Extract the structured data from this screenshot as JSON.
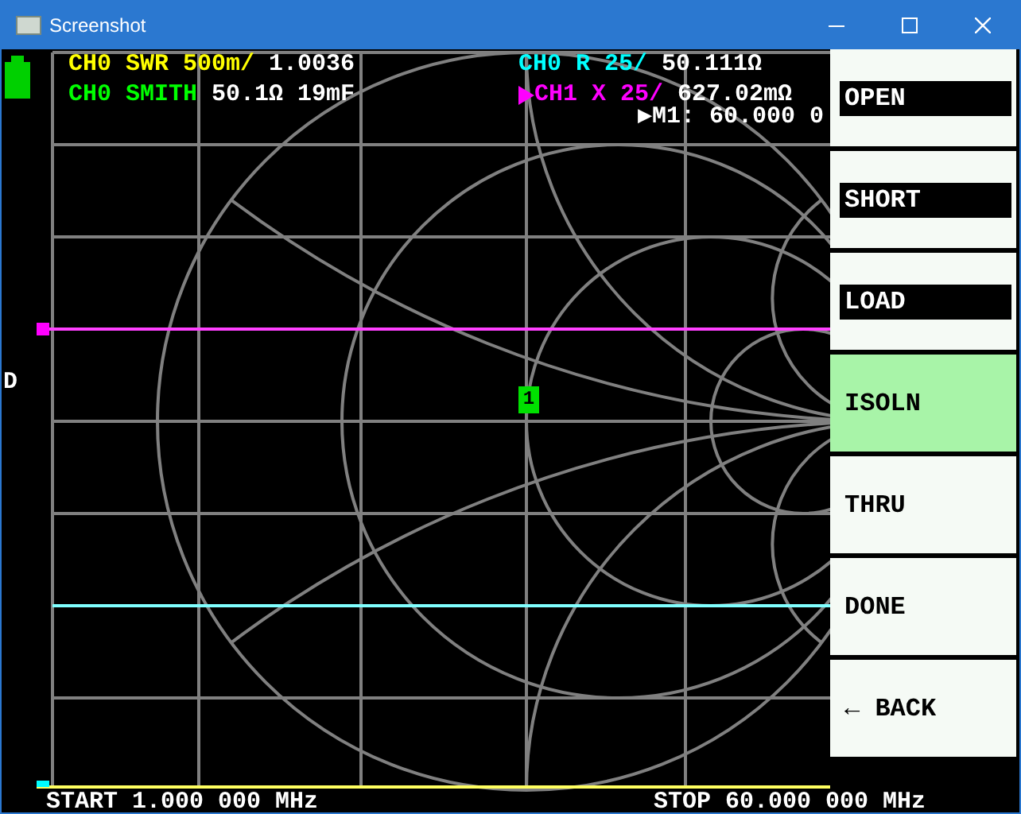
{
  "window": {
    "title": "Screenshot"
  },
  "traces": [
    {
      "label": "CH0 SWR 500m/",
      "value": "1.0036",
      "color": "#ffff00",
      "active": false
    },
    {
      "label": "CH0 SMITH",
      "value": "50.1Ω 19mF",
      "color": "#00ff00",
      "active": false
    },
    {
      "label": "CH0 R 25/",
      "value": "50.111Ω",
      "color": "#00ffff",
      "active": false
    },
    {
      "label": "CH1 X 25/",
      "value": "627.02mΩ",
      "color": "#ff00ff",
      "active": true
    }
  ],
  "marker_readout": "▶M1: 60.000 0",
  "marker_badge": "1",
  "side_label": "D",
  "sweep": {
    "start": "START 1.000 000 MHz",
    "stop": "STOP 60.000 000 MHz"
  },
  "menu": [
    {
      "label": "OPEN",
      "inverted": true,
      "selected": false
    },
    {
      "label": "SHORT",
      "inverted": true,
      "selected": false
    },
    {
      "label": "LOAD",
      "inverted": true,
      "selected": false
    },
    {
      "label": "ISOLN",
      "inverted": false,
      "selected": true
    },
    {
      "label": "THRU",
      "inverted": false,
      "selected": false
    },
    {
      "label": "DONE",
      "inverted": false,
      "selected": false
    },
    {
      "label": "← BACK",
      "inverted": false,
      "selected": false
    }
  ]
}
